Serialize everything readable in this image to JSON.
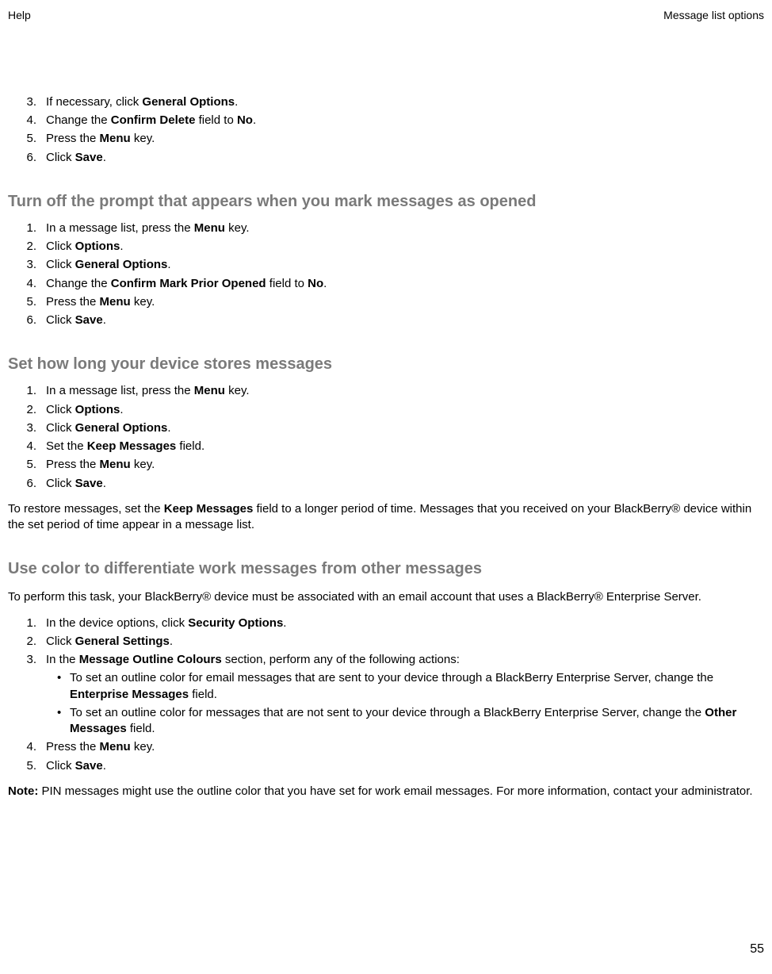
{
  "header": {
    "left": "Help",
    "right": "Message list options"
  },
  "section1": {
    "items": [
      {
        "num": "3.",
        "pre": "If necessary, click ",
        "bold": "General Options",
        "post": "."
      },
      {
        "num": "4.",
        "pre": "Change the ",
        "bold": "Confirm Delete",
        "mid": " field to ",
        "bold2": "No",
        "post": "."
      },
      {
        "num": "5.",
        "pre": "Press the ",
        "bold": "Menu",
        "post": " key."
      },
      {
        "num": "6.",
        "pre": "Click ",
        "bold": "Save",
        "post": "."
      }
    ]
  },
  "section2": {
    "heading": "Turn off the prompt that appears when you mark messages as opened",
    "items": [
      {
        "num": "1.",
        "pre": "In a message list, press the ",
        "bold": "Menu",
        "post": " key."
      },
      {
        "num": "2.",
        "pre": "Click ",
        "bold": "Options",
        "post": "."
      },
      {
        "num": "3.",
        "pre": "Click ",
        "bold": "General Options",
        "post": "."
      },
      {
        "num": "4.",
        "pre": "Change the ",
        "bold": "Confirm Mark Prior Opened",
        "mid": " field to ",
        "bold2": "No",
        "post": "."
      },
      {
        "num": "5.",
        "pre": "Press the ",
        "bold": "Menu",
        "post": " key."
      },
      {
        "num": "6.",
        "pre": "Click ",
        "bold": "Save",
        "post": "."
      }
    ]
  },
  "section3": {
    "heading": "Set how long your device stores messages",
    "items": [
      {
        "num": "1.",
        "pre": "In a message list, press the ",
        "bold": "Menu",
        "post": " key."
      },
      {
        "num": "2.",
        "pre": "Click ",
        "bold": "Options",
        "post": "."
      },
      {
        "num": "3.",
        "pre": "Click ",
        "bold": "General Options",
        "post": "."
      },
      {
        "num": "4.",
        "pre": "Set the ",
        "bold": "Keep Messages",
        "post": " field."
      },
      {
        "num": "5.",
        "pre": "Press the ",
        "bold": "Menu",
        "post": " key."
      },
      {
        "num": "6.",
        "pre": "Click ",
        "bold": "Save",
        "post": "."
      }
    ],
    "para_pre": "To restore messages, set the ",
    "para_bold": "Keep Messages",
    "para_post": " field to a longer period of time. Messages that you received on your BlackBerry® device within the set period of time appear in a message list."
  },
  "section4": {
    "heading": "Use color to differentiate work messages from other messages",
    "intro": "To perform this task, your BlackBerry® device must be associated with an email account that uses a BlackBerry® Enterprise Server.",
    "items": [
      {
        "num": "1.",
        "pre": "In the device options, click ",
        "bold": "Security Options",
        "post": "."
      },
      {
        "num": "2.",
        "pre": "Click ",
        "bold": "General Settings",
        "post": "."
      },
      {
        "num": "3.",
        "pre": "In the ",
        "bold": "Message Outline Colours",
        "post": " section, perform any of the following actions:"
      }
    ],
    "bullets": [
      {
        "pre": "To set an outline color for email messages that are sent to your device through a BlackBerry Enterprise Server, change the ",
        "bold": "Enterprise Messages",
        "post": " field."
      },
      {
        "pre": "To set an outline color for messages that are not sent to your device through a BlackBerry Enterprise Server, change the ",
        "bold": "Other Messages",
        "post": " field."
      }
    ],
    "items2": [
      {
        "num": "4.",
        "pre": "Press the ",
        "bold": "Menu",
        "post": " key."
      },
      {
        "num": "5.",
        "pre": "Click ",
        "bold": "Save",
        "post": "."
      }
    ],
    "note_bold": "Note:",
    "note_text": "  PIN messages might use the outline color that you have set for work email messages. For more information, contact your administrator."
  },
  "page_number": "55"
}
